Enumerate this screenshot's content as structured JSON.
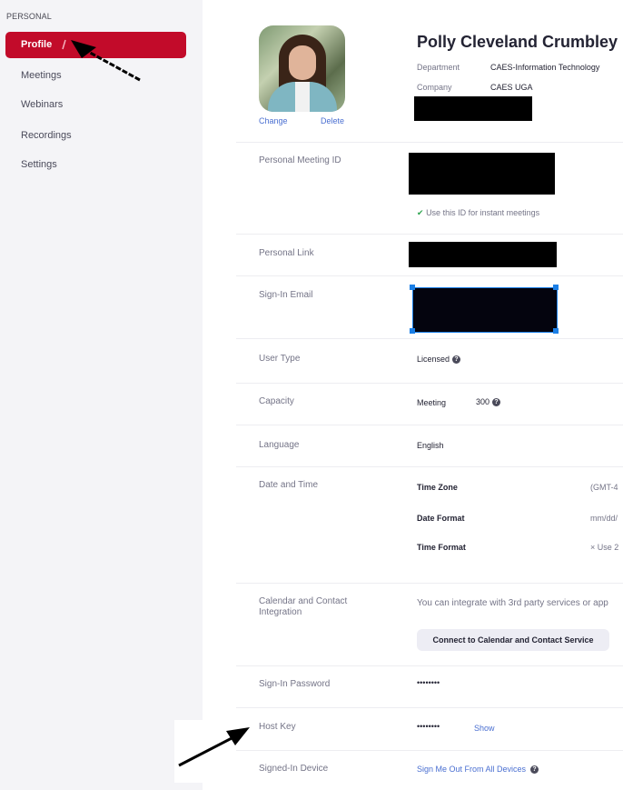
{
  "sidebar": {
    "section": "PERSONAL",
    "items": [
      {
        "label": "Profile",
        "active": true
      },
      {
        "label": "Meetings"
      },
      {
        "label": "Webinars"
      },
      {
        "label": "Recordings"
      },
      {
        "label": "Settings"
      }
    ],
    "accent_color": "#c20b2a"
  },
  "profile": {
    "name": "Polly Cleveland Crumbley",
    "change_label": "Change",
    "delete_label": "Delete",
    "department_label": "Department",
    "department": "CAES-Information Technology",
    "company_label": "Company",
    "company": "CAES UGA"
  },
  "rows": {
    "pmi": {
      "label": "Personal Meeting ID",
      "instant": "Use this ID for instant meetings"
    },
    "personal_link": {
      "label": "Personal Link"
    },
    "email": {
      "label": "Sign-In Email"
    },
    "user_type": {
      "label": "User Type",
      "value": "Licensed"
    },
    "capacity": {
      "label": "Capacity",
      "type": "Meeting",
      "value": "300"
    },
    "language": {
      "label": "Language",
      "value": "English"
    },
    "datetime": {
      "label": "Date and Time",
      "time_zone_label": "Time Zone",
      "time_zone": "(GMT-4",
      "date_format_label": "Date Format",
      "date_format": "mm/dd/",
      "time_format_label": "Time Format",
      "time_format": "Use 2"
    },
    "calendar": {
      "label": "Calendar and Contact Integration",
      "text": "You can integrate with 3rd party services or app",
      "button": "Connect to Calendar and Contact Service"
    },
    "password": {
      "label": "Sign-In Password",
      "value": "••••••••"
    },
    "host_key": {
      "label": "Host Key",
      "value": "••••••••",
      "show": "Show"
    },
    "device": {
      "label": "Signed-In Device",
      "link": "Sign Me Out From All Devices"
    }
  }
}
